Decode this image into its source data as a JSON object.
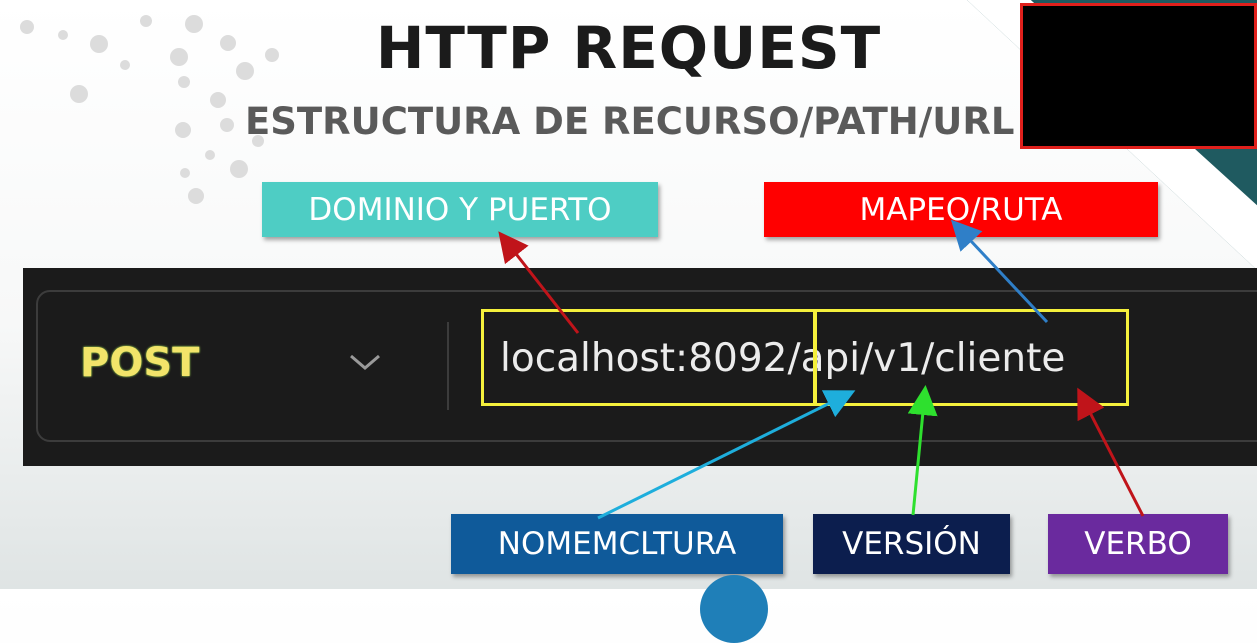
{
  "slide": {
    "title": "HTTP REQUEST",
    "subtitle": "ESTRUCTURA DE RECURSO/PATH/URL"
  },
  "labels": {
    "dominio": "DOMINIO Y PUERTO",
    "mapeo": "MAPEO/RUTA",
    "nomenclatura": "NOMEMCLTURA",
    "version": "VERSIÓN",
    "verbo": "VERBO"
  },
  "request_bar": {
    "method": "POST",
    "url_domain": "localhost:8092",
    "url_path": "/api/v1/cliente"
  },
  "colors": {
    "dominio_bg": "#4ecdc4",
    "mapeo_bg": "#ff0000",
    "nomenclatura_bg": "#0f5a9a",
    "version_bg": "#0c1e4e",
    "verbo_bg": "#6a2a9e",
    "highlight": "#f5f03c"
  }
}
